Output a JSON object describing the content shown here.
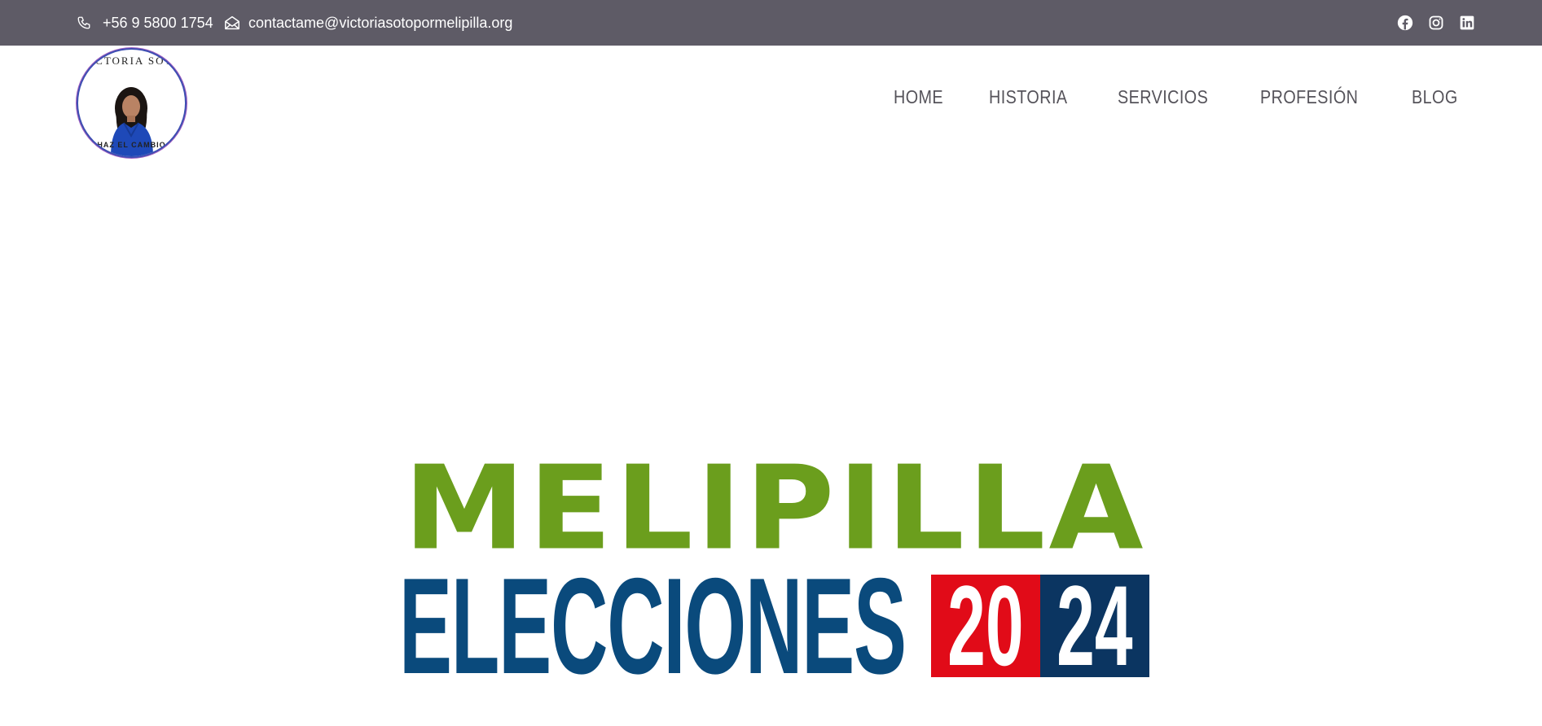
{
  "topbar": {
    "phone": "+56 9 5800 1754",
    "email": "contactame@victoriasotopormelipilla.org",
    "social": [
      "facebook-icon",
      "instagram-icon",
      "linkedin-icon"
    ],
    "background": "#5e5b66"
  },
  "logo": {
    "top_text": "VICTORIA SOTO",
    "bottom_text": "HAZ EL CAMBIO"
  },
  "nav": {
    "items": [
      {
        "label": "HOME"
      },
      {
        "label": "HISTORIA"
      },
      {
        "label": "SERVICIOS"
      },
      {
        "label": "PROFESIÓN"
      },
      {
        "label": "BLOG"
      }
    ]
  },
  "banner": {
    "line1": "MELIPILLA",
    "line2": "ELECCIONES",
    "year_part1": "20",
    "year_part2": "24",
    "colors": {
      "green": "#6b9e1d",
      "blue": "#0a4a7c",
      "red": "#e10b18",
      "navy": "#0b3561"
    }
  }
}
